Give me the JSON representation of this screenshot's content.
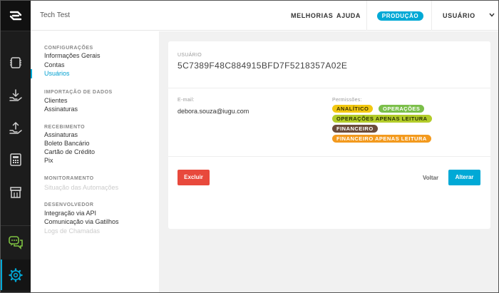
{
  "app": {
    "title": "Tech Test"
  },
  "header": {
    "nav": [
      "MELHORIAS",
      "AJUDA"
    ],
    "environment": "PRODUÇÃO",
    "user_menu": "USUÁRIO"
  },
  "rail": {
    "icons": [
      "logo-icon",
      "cards-icon",
      "receive-icon",
      "transfer-icon",
      "calculator-icon",
      "store-icon",
      "chat-icon",
      "settings-icon"
    ],
    "accent": "#00a8d6"
  },
  "sidebar": {
    "sections": [
      {
        "heading": "CONFIGURAÇÕES",
        "items": [
          {
            "label": "Informações Gerais",
            "state": "normal"
          },
          {
            "label": "Contas",
            "state": "normal"
          },
          {
            "label": "Usuários",
            "state": "active"
          }
        ]
      },
      {
        "heading": "IMPORTAÇÃO DE DADOS",
        "items": [
          {
            "label": "Clientes",
            "state": "normal"
          },
          {
            "label": "Assinaturas",
            "state": "normal"
          }
        ]
      },
      {
        "heading": "RECEBIMENTO",
        "items": [
          {
            "label": "Assinaturas",
            "state": "normal"
          },
          {
            "label": "Boleto Bancário",
            "state": "normal"
          },
          {
            "label": "Cartão de Crédito",
            "state": "normal"
          },
          {
            "label": "Pix",
            "state": "normal"
          }
        ]
      },
      {
        "heading": "MONITORAMENTO",
        "items": [
          {
            "label": "Situação das Automações",
            "state": "disabled"
          }
        ]
      },
      {
        "heading": "DESENVOLVEDOR",
        "items": [
          {
            "label": "Integração via API",
            "state": "normal"
          },
          {
            "label": "Comunicação via Gatilhos",
            "state": "normal"
          },
          {
            "label": "Logs de Chamadas",
            "state": "disabled"
          }
        ]
      }
    ]
  },
  "user_card": {
    "section_label": "USUÁRIO",
    "id": "5C7389F48C884915BFD7F5218357A02E",
    "email_label": "E-mail:",
    "email": "debora.souza@iugu.com",
    "permissions_label": "Permissões:",
    "permissions": [
      {
        "label": "ANALÍTICO",
        "bg": "#f2c811",
        "fg": "#3a3000"
      },
      {
        "label": "OPERAÇÕES",
        "bg": "#7bbf4a",
        "fg": "#ffffff"
      },
      {
        "label": "OPERAÇÕES APENAS LEITURA",
        "bg": "#b3cc2a",
        "fg": "#2a3300"
      },
      {
        "label": "FINANCEIRO",
        "bg": "#6b4c3b",
        "fg": "#ffffff"
      },
      {
        "label": "FINANCEIRO APENAS LEITURA",
        "bg": "#f39a1e",
        "fg": "#ffffff"
      }
    ],
    "delete_label": "Excluir",
    "back_label": "Voltar",
    "edit_label": "Alterar"
  }
}
